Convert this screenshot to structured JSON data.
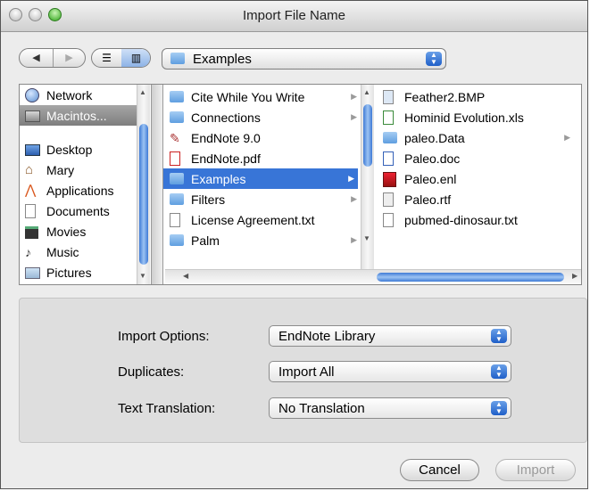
{
  "window": {
    "title": "Import File Name"
  },
  "toolbar": {
    "back_icon": "back-arrow",
    "forward_icon": "forward-arrow",
    "view_list_icon": "list-view",
    "view_columns_icon": "column-view",
    "path": "Examples"
  },
  "sidebar": {
    "items": [
      {
        "label": "Network",
        "icon": "network-globe"
      },
      {
        "label": "Macintos...",
        "icon": "hard-disk",
        "selected": true
      },
      {
        "label": "Desktop",
        "icon": "desktop"
      },
      {
        "label": "Mary",
        "icon": "home"
      },
      {
        "label": "Applications",
        "icon": "applications"
      },
      {
        "label": "Documents",
        "icon": "documents"
      },
      {
        "label": "Movies",
        "icon": "movies"
      },
      {
        "label": "Music",
        "icon": "music"
      },
      {
        "label": "Pictures",
        "icon": "pictures"
      }
    ]
  },
  "column1": {
    "items": [
      {
        "label": "Cite While You Write",
        "icon": "folder",
        "has_children": true
      },
      {
        "label": "Connections",
        "icon": "folder",
        "has_children": true
      },
      {
        "label": "EndNote 9.0",
        "icon": "endnote-app"
      },
      {
        "label": "EndNote.pdf",
        "icon": "pdf"
      },
      {
        "label": "Examples",
        "icon": "folder",
        "has_children": true,
        "selected": true
      },
      {
        "label": "Filters",
        "icon": "folder",
        "has_children": true
      },
      {
        "label": "License Agreement.txt",
        "icon": "text-file"
      },
      {
        "label": "Palm",
        "icon": "folder",
        "has_children": true
      }
    ]
  },
  "column2": {
    "items": [
      {
        "label": "Feather2.BMP",
        "icon": "image-file"
      },
      {
        "label": "Hominid Evolution.xls",
        "icon": "spreadsheet"
      },
      {
        "label": "paleo.Data",
        "icon": "folder",
        "has_children": true
      },
      {
        "label": "Paleo.doc",
        "icon": "word-doc"
      },
      {
        "label": "Paleo.enl",
        "icon": "endnote-library"
      },
      {
        "label": "Paleo.rtf",
        "icon": "rtf-doc"
      },
      {
        "label": "pubmed-dinosaur.txt",
        "icon": "text-file"
      }
    ]
  },
  "options": {
    "import_options": {
      "label": "Import Options:",
      "value": "EndNote Library"
    },
    "duplicates": {
      "label": "Duplicates:",
      "value": "Import All"
    },
    "text_translation": {
      "label": "Text Translation:",
      "value": "No Translation"
    }
  },
  "buttons": {
    "cancel": "Cancel",
    "import": "Import"
  },
  "colors": {
    "selection": "#3875d7",
    "window_bg": "#ececec",
    "accent": "#1f5fc8"
  }
}
